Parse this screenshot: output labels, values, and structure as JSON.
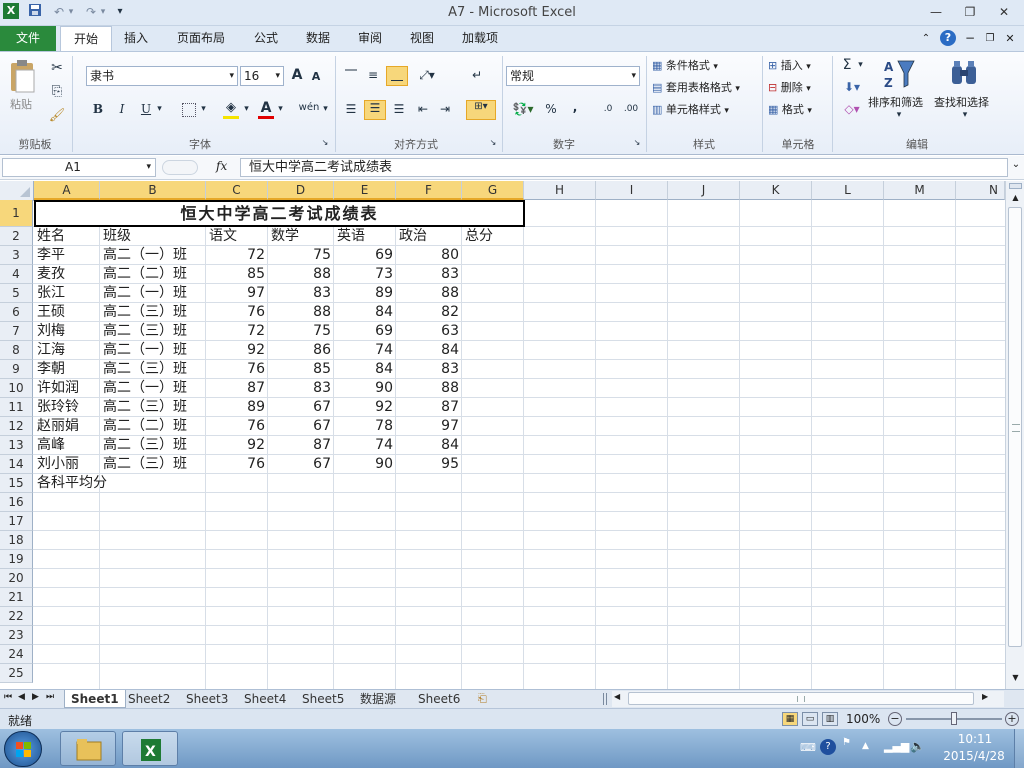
{
  "window": {
    "title": "A7  -  Microsoft Excel"
  },
  "quick_access": {
    "save_icon": "save-icon",
    "undo_icon": "undo-icon",
    "redo_icon": "redo-icon",
    "customize_glyph": "▾"
  },
  "window_controls": {
    "minimize": "—",
    "maximize": "❐",
    "close": "✕"
  },
  "ribbon_tabs": [
    "文件",
    "开始",
    "插入",
    "页面布局",
    "公式",
    "数据",
    "审阅",
    "视图",
    "加载项"
  ],
  "ribbon": {
    "clipboard": {
      "paste_label": "粘贴",
      "group_label": "剪贴板"
    },
    "font": {
      "font_name": "隶书",
      "font_size": "16",
      "bold": "B",
      "italic": "I",
      "underline": "U",
      "grow": "A",
      "shrink": "A",
      "phonetic": "wén",
      "group_label": "字体"
    },
    "alignment": {
      "group_label": "对齐方式"
    },
    "number": {
      "format": "常规",
      "percent": "%",
      "comma": ",",
      "inc_decimal": ".0",
      "dec_decimal": ".00",
      "group_label": "数字"
    },
    "styles": {
      "conditional": "条件格式",
      "table": "套用表格格式",
      "cell_styles": "单元格样式",
      "group_label": "样式"
    },
    "cells": {
      "insert": "插入",
      "delete": "删除",
      "format": "格式",
      "group_label": "单元格"
    },
    "editing": {
      "sum": "Σ",
      "sort_filter": "排序和筛选",
      "find_select": "查找和选择",
      "group_label": "编辑"
    }
  },
  "formula_bar": {
    "name_box": "A1",
    "fx": "fx",
    "content": "恒大中学高二考试成绩表"
  },
  "columns": [
    "A",
    "B",
    "C",
    "D",
    "E",
    "F",
    "G",
    "H",
    "I",
    "J",
    "K",
    "L",
    "M",
    "N"
  ],
  "rows": [
    "1",
    "2",
    "3",
    "4",
    "5",
    "6",
    "7",
    "8",
    "9",
    "10",
    "11",
    "12",
    "13",
    "14",
    "15",
    "16",
    "17",
    "18",
    "19",
    "20",
    "21",
    "22",
    "23",
    "24",
    "25"
  ],
  "sheet": {
    "title": "恒大中学高二考试成绩表",
    "headers": [
      "姓名",
      "班级",
      "语文",
      "数学",
      "英语",
      "政治",
      "总分"
    ],
    "data": [
      [
        "李平",
        "高二（一）班",
        "72",
        "75",
        "69",
        "80"
      ],
      [
        "麦孜",
        "高二（二）班",
        "85",
        "88",
        "73",
        "83"
      ],
      [
        "张江",
        "高二（一）班",
        "97",
        "83",
        "89",
        "88"
      ],
      [
        "王硕",
        "高二（三）班",
        "76",
        "88",
        "84",
        "82"
      ],
      [
        "刘梅",
        "高二（三）班",
        "72",
        "75",
        "69",
        "63"
      ],
      [
        "江海",
        "高二（一）班",
        "92",
        "86",
        "74",
        "84"
      ],
      [
        "李朝",
        "高二（三）班",
        "76",
        "85",
        "84",
        "83"
      ],
      [
        "许如润",
        "高二（一）班",
        "87",
        "83",
        "90",
        "88"
      ],
      [
        "张玲铃",
        "高二（三）班",
        "89",
        "67",
        "92",
        "87"
      ],
      [
        "赵丽娟",
        "高二（二）班",
        "76",
        "67",
        "78",
        "97"
      ],
      [
        "高峰",
        "高二（三）班",
        "92",
        "87",
        "74",
        "84"
      ],
      [
        "刘小丽",
        "高二（三）班",
        "76",
        "67",
        "90",
        "95"
      ]
    ],
    "footer": "各科平均分"
  },
  "sheet_tabs": [
    "Sheet1",
    "Sheet2",
    "Sheet3",
    "Sheet4",
    "Sheet5",
    "数据源",
    "Sheet6"
  ],
  "active_sheet": "Sheet1",
  "status": {
    "ready": "就绪",
    "zoom": "100%"
  },
  "taskbar": {
    "time": "10:11",
    "date": "2015/4/28"
  },
  "colors": {
    "file_tab": "#2a8a3c",
    "selected_header": "#f7d77b",
    "accent": "#e6a828"
  }
}
